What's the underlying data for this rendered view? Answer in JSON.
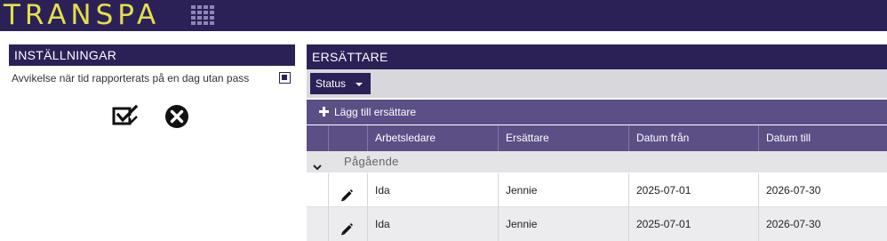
{
  "app": {
    "logo_text": "TRANSPA",
    "apps_menu_icon": "grid-icon",
    "colors": {
      "header": "#2c2157",
      "logo": "#e3e04a",
      "toolbar": "#5c4f86"
    }
  },
  "settings_panel": {
    "title": "INSTÄLLNINGAR",
    "option_label": "Avvikelse när tid rapporterats på en dag utan pass",
    "option_checked": true,
    "save_icon": "check-edit-icon",
    "cancel_icon": "close-circle-icon"
  },
  "substitutes_panel": {
    "title": "ERSÄTTARE",
    "status_button_label": "Status",
    "add_button_label": "Lägg till ersättare",
    "columns": [
      "Arbetsledare",
      "Ersättare",
      "Datum från",
      "Datum till"
    ],
    "group": {
      "label": "Pågående",
      "expanded": true
    },
    "rows": [
      {
        "arbetsledare": "Ida",
        "ersattare": "Jennie",
        "datum_fran": "2025-07-01",
        "datum_till": "2026-07-30",
        "edit_icon": "pencil-icon"
      },
      {
        "arbetsledare": "Ida",
        "ersattare": "Jennie",
        "datum_fran": "2025-07-01",
        "datum_till": "2026-07-30",
        "edit_icon": "pencil-icon"
      }
    ]
  }
}
